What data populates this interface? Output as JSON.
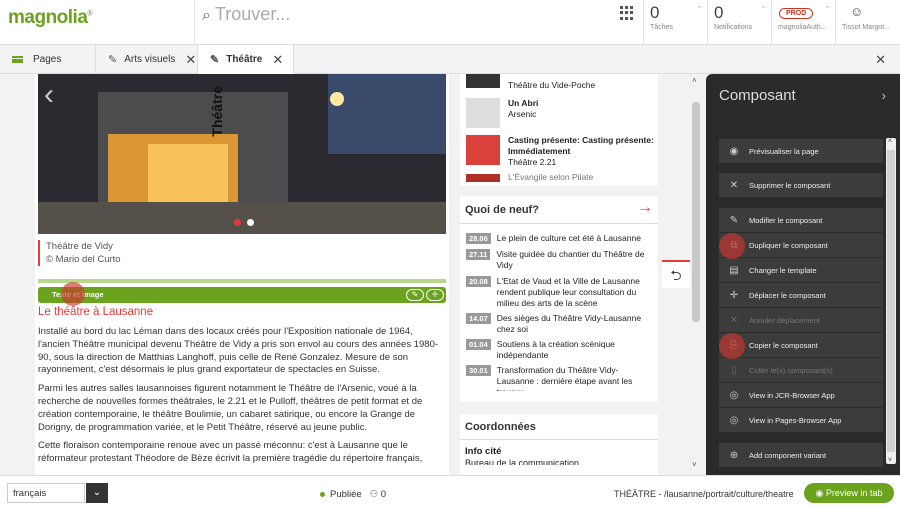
{
  "header": {
    "logo": "magnolia",
    "search_placeholder": "Trouver...",
    "tasks": {
      "count": "0",
      "label": "Tâches"
    },
    "notifications": {
      "count": "0",
      "label": "Notifications"
    },
    "instance": {
      "badge": "PROD",
      "label": "magnoliaAuth..."
    },
    "user": {
      "label": "Tissot Margot..."
    }
  },
  "tabs": [
    {
      "label": "Pages"
    },
    {
      "label": "Arts visuels"
    },
    {
      "label": "Théâtre"
    }
  ],
  "hero": {
    "vertical_text": "Théâtre"
  },
  "caption": {
    "line1": "Théâtre de Vidy",
    "line2": "© Mario del Curto"
  },
  "component_bar": {
    "label": "Texte et image"
  },
  "article": {
    "title": "Le théâtre à Lausanne",
    "paragraphs": [
      "Installé au bord du lac Léman dans des locaux créés pour l'Exposition nationale de 1964, l'ancien Théâtre municipal devenu Théâtre de Vidy a pris son envol au cours des années 1980-90, sous la direction de Matthias Langhoff, puis celle de René Gonzalez. Mesure de son rayonnement, c'est désormais le plus grand exportateur de spectacles en Suisse.",
      "Parmi les autres salles lausannoises figurent notamment le Théâtre de l'Arsenic, voué à la recherche de nouvelles formes théâtrales, le 2.21 et le Pulloff, théâtres de petit format et de création contemporaine, le théâtre Boulimie, un cabaret satirique, ou encore la Grange de Dorigny, de programmation variée, et le Petit Théâtre, réservé au jeune public.",
      "Cette floraison contemporaine renoue avec un passé méconnu: c'est à Lausanne que le réformateur protestant Théodore de Bèze écrivit la première tragédie du répertoire français,"
    ]
  },
  "events": [
    {
      "title": "",
      "venue": "Théâtre du Vide-Poche"
    },
    {
      "title": "Un Abri",
      "venue": "Arsenic"
    },
    {
      "title": "Casting présente: Casting présente: Immédiatement",
      "venue": "Théâtre 2.21"
    },
    {
      "title": "",
      "venue": "L'Évangile selon Pilate"
    }
  ],
  "news": {
    "title": "Quoi de neuf?",
    "items": [
      {
        "date": "28.06",
        "text": "Le plein de culture cet été à Lausanne"
      },
      {
        "date": "27.11",
        "text": "Visite guidée du chantier du Théâtre de Vidy"
      },
      {
        "date": "20.08",
        "text": "L'Etat de Vaud et la Ville de Lausanne rendent publique leur consultation du milieu des arts de la scène"
      },
      {
        "date": "14.07",
        "text": "Des sièges du Théâtre Vidy-Lausanne chez soi"
      },
      {
        "date": "01.04",
        "text": "Soutiens à la création scénique indépendante"
      },
      {
        "date": "30.01",
        "text": "Transformation du Théâtre Vidy-Lausanne : dernière étape avant les travaux"
      }
    ]
  },
  "coords": {
    "title": "Coordonnées",
    "subtitle": "Info cité",
    "line": "Bureau de la communication"
  },
  "panel": {
    "title": "Composant",
    "actions": [
      {
        "label": "Prévisualiser la page",
        "icon": "eye-icon",
        "disabled": false
      },
      {
        "label": "Supprimer le composant",
        "icon": "close-icon",
        "disabled": false
      },
      {
        "label": "Modifier le composant",
        "icon": "pencil-icon",
        "disabled": false
      },
      {
        "label": "Dupliquer le composant",
        "icon": "duplicate-icon",
        "disabled": false
      },
      {
        "label": "Changer le template",
        "icon": "template-icon",
        "disabled": false
      },
      {
        "label": "Déplacer le composant",
        "icon": "move-icon",
        "disabled": false
      },
      {
        "label": "Annuler déplacement",
        "icon": "cancel-icon",
        "disabled": true
      },
      {
        "label": "Copier le composant",
        "icon": "copy-icon",
        "disabled": false
      },
      {
        "label": "Coller le(s) composant(s)",
        "icon": "paste-icon",
        "disabled": true
      },
      {
        "label": "View in JCR-Browser App",
        "icon": "view-icon",
        "disabled": false
      },
      {
        "label": "View in Pages-Browser App",
        "icon": "view-icon",
        "disabled": false
      },
      {
        "label": "Add component variant",
        "icon": "variant-icon",
        "disabled": false
      }
    ]
  },
  "footer": {
    "language": "français",
    "status": "Publiée",
    "users": "0",
    "path": "THÉÂTRE - /lausanne/portrait/culture/theatre",
    "preview": "Preview in tab"
  }
}
